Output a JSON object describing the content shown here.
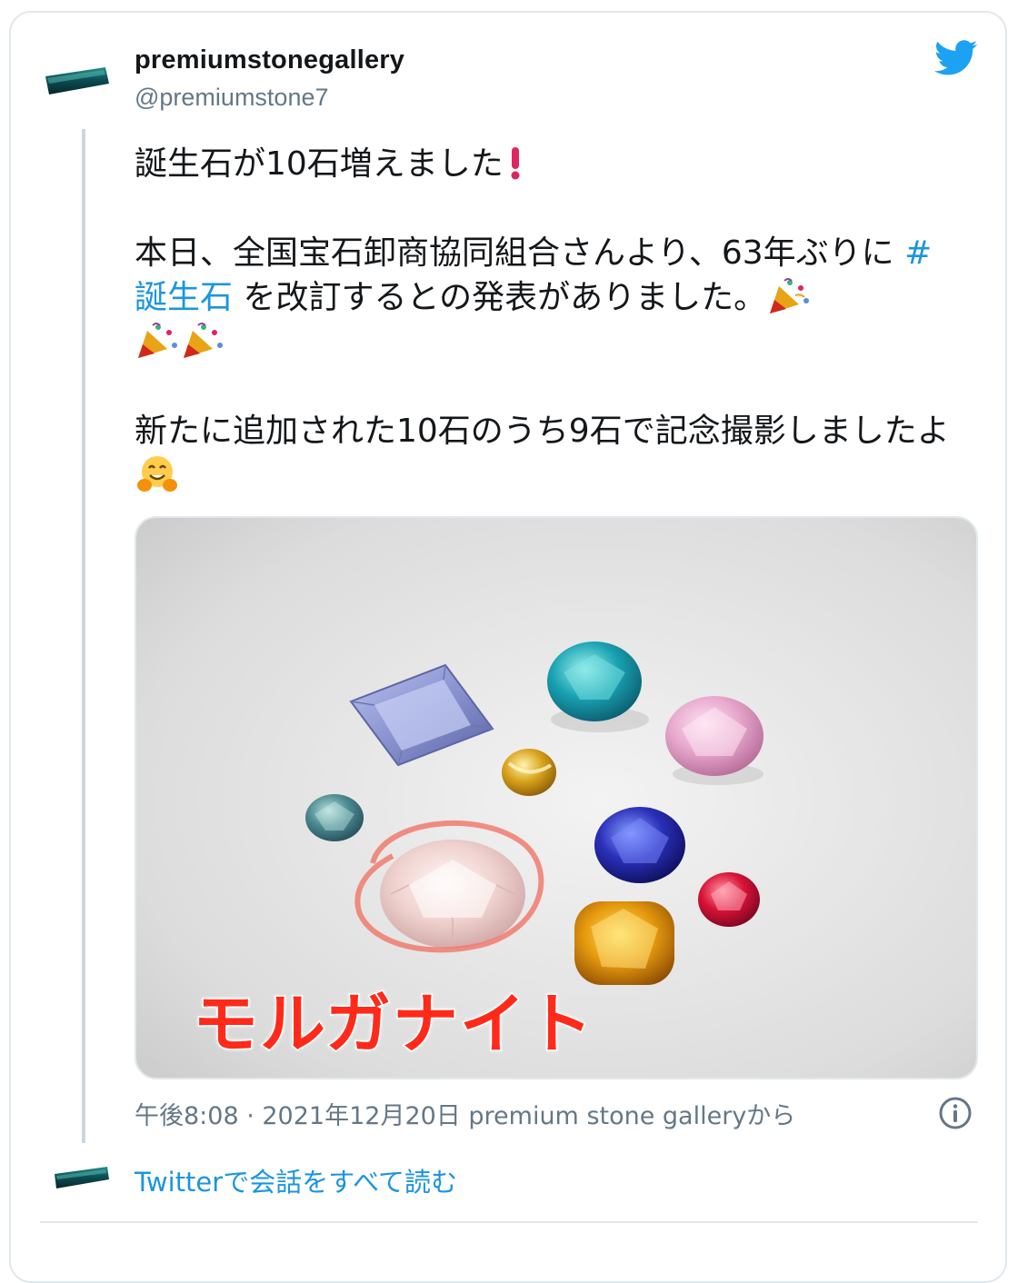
{
  "user": {
    "display_name": "premiumstonegallery",
    "handle": "@premiumstone7"
  },
  "tweet": {
    "line1": "誕生石が10石増えました",
    "para2_part1": "本日、全国宝石卸商協同組合さんより、63年ぶりに ",
    "hashtag": "#誕生石",
    "para2_part2": " を改訂するとの発表がありました。",
    "para3": "新たに追加された10石のうち9石で記念撮影しましたよ"
  },
  "media": {
    "overlay_label": "モルガナイト"
  },
  "meta": {
    "timestamp": "午後8:08 · 2021年12月20日 premium stone galleryから"
  },
  "footer": {
    "read_link": "Twitterで会話をすべて読む"
  },
  "colors": {
    "accent": "#1b95e0",
    "twitter_blue": "#1da1f2",
    "label_red": "#ff2a1a"
  },
  "icons": [
    "twitter-bird-icon",
    "info-icon",
    "party-popper-emoji",
    "hugging-face-emoji",
    "exclamation-emoji"
  ]
}
